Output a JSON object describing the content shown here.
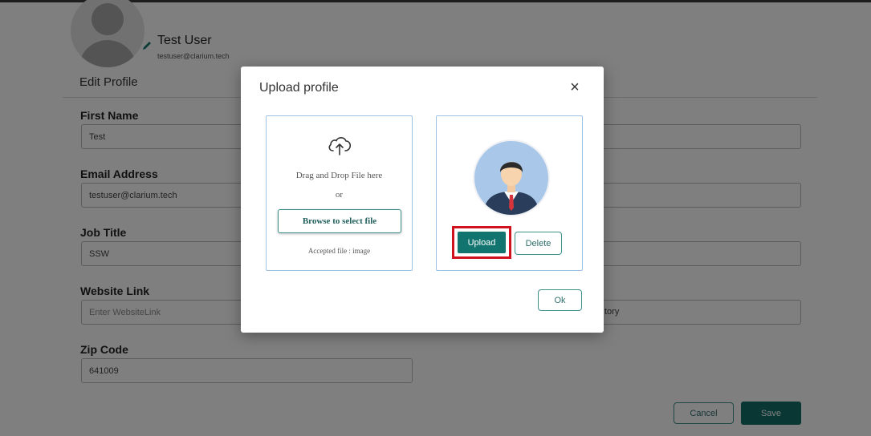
{
  "profile": {
    "name": "Test User",
    "email": "testuser@clarium.tech",
    "section_title": "Edit Profile"
  },
  "form": {
    "first_name": {
      "label": "First Name",
      "value": "Test"
    },
    "email": {
      "label": "Email Address",
      "value": "testuser@clarium.tech"
    },
    "job_title": {
      "label": "Job Title",
      "value": "SSW"
    },
    "website": {
      "label": "Website Link",
      "value": "",
      "placeholder": "Enter WebsiteLink"
    },
    "right_field_partial_text": "tory",
    "zip_code": {
      "label": "Zip Code",
      "value": "641009"
    },
    "cancel_label": "Cancel",
    "save_label": "Save"
  },
  "modal": {
    "title": "Upload profile",
    "close_glyph": "×",
    "dropzone": {
      "drag_text": "Drag and Drop File here",
      "or_text": "or",
      "browse_label": "Browse to select file",
      "accepted_text": "Accepted file : image"
    },
    "preview": {
      "upload_label": "Upload",
      "delete_label": "Delete"
    },
    "ok_label": "Ok"
  },
  "colors": {
    "brand_teal": "#116e69",
    "highlight_red": "#d0121f",
    "box_border": "#9dc2e6"
  },
  "icons": [
    "user-placeholder-icon",
    "pencil-icon",
    "cloud-upload-icon",
    "person-avatar-icon",
    "close-icon"
  ]
}
